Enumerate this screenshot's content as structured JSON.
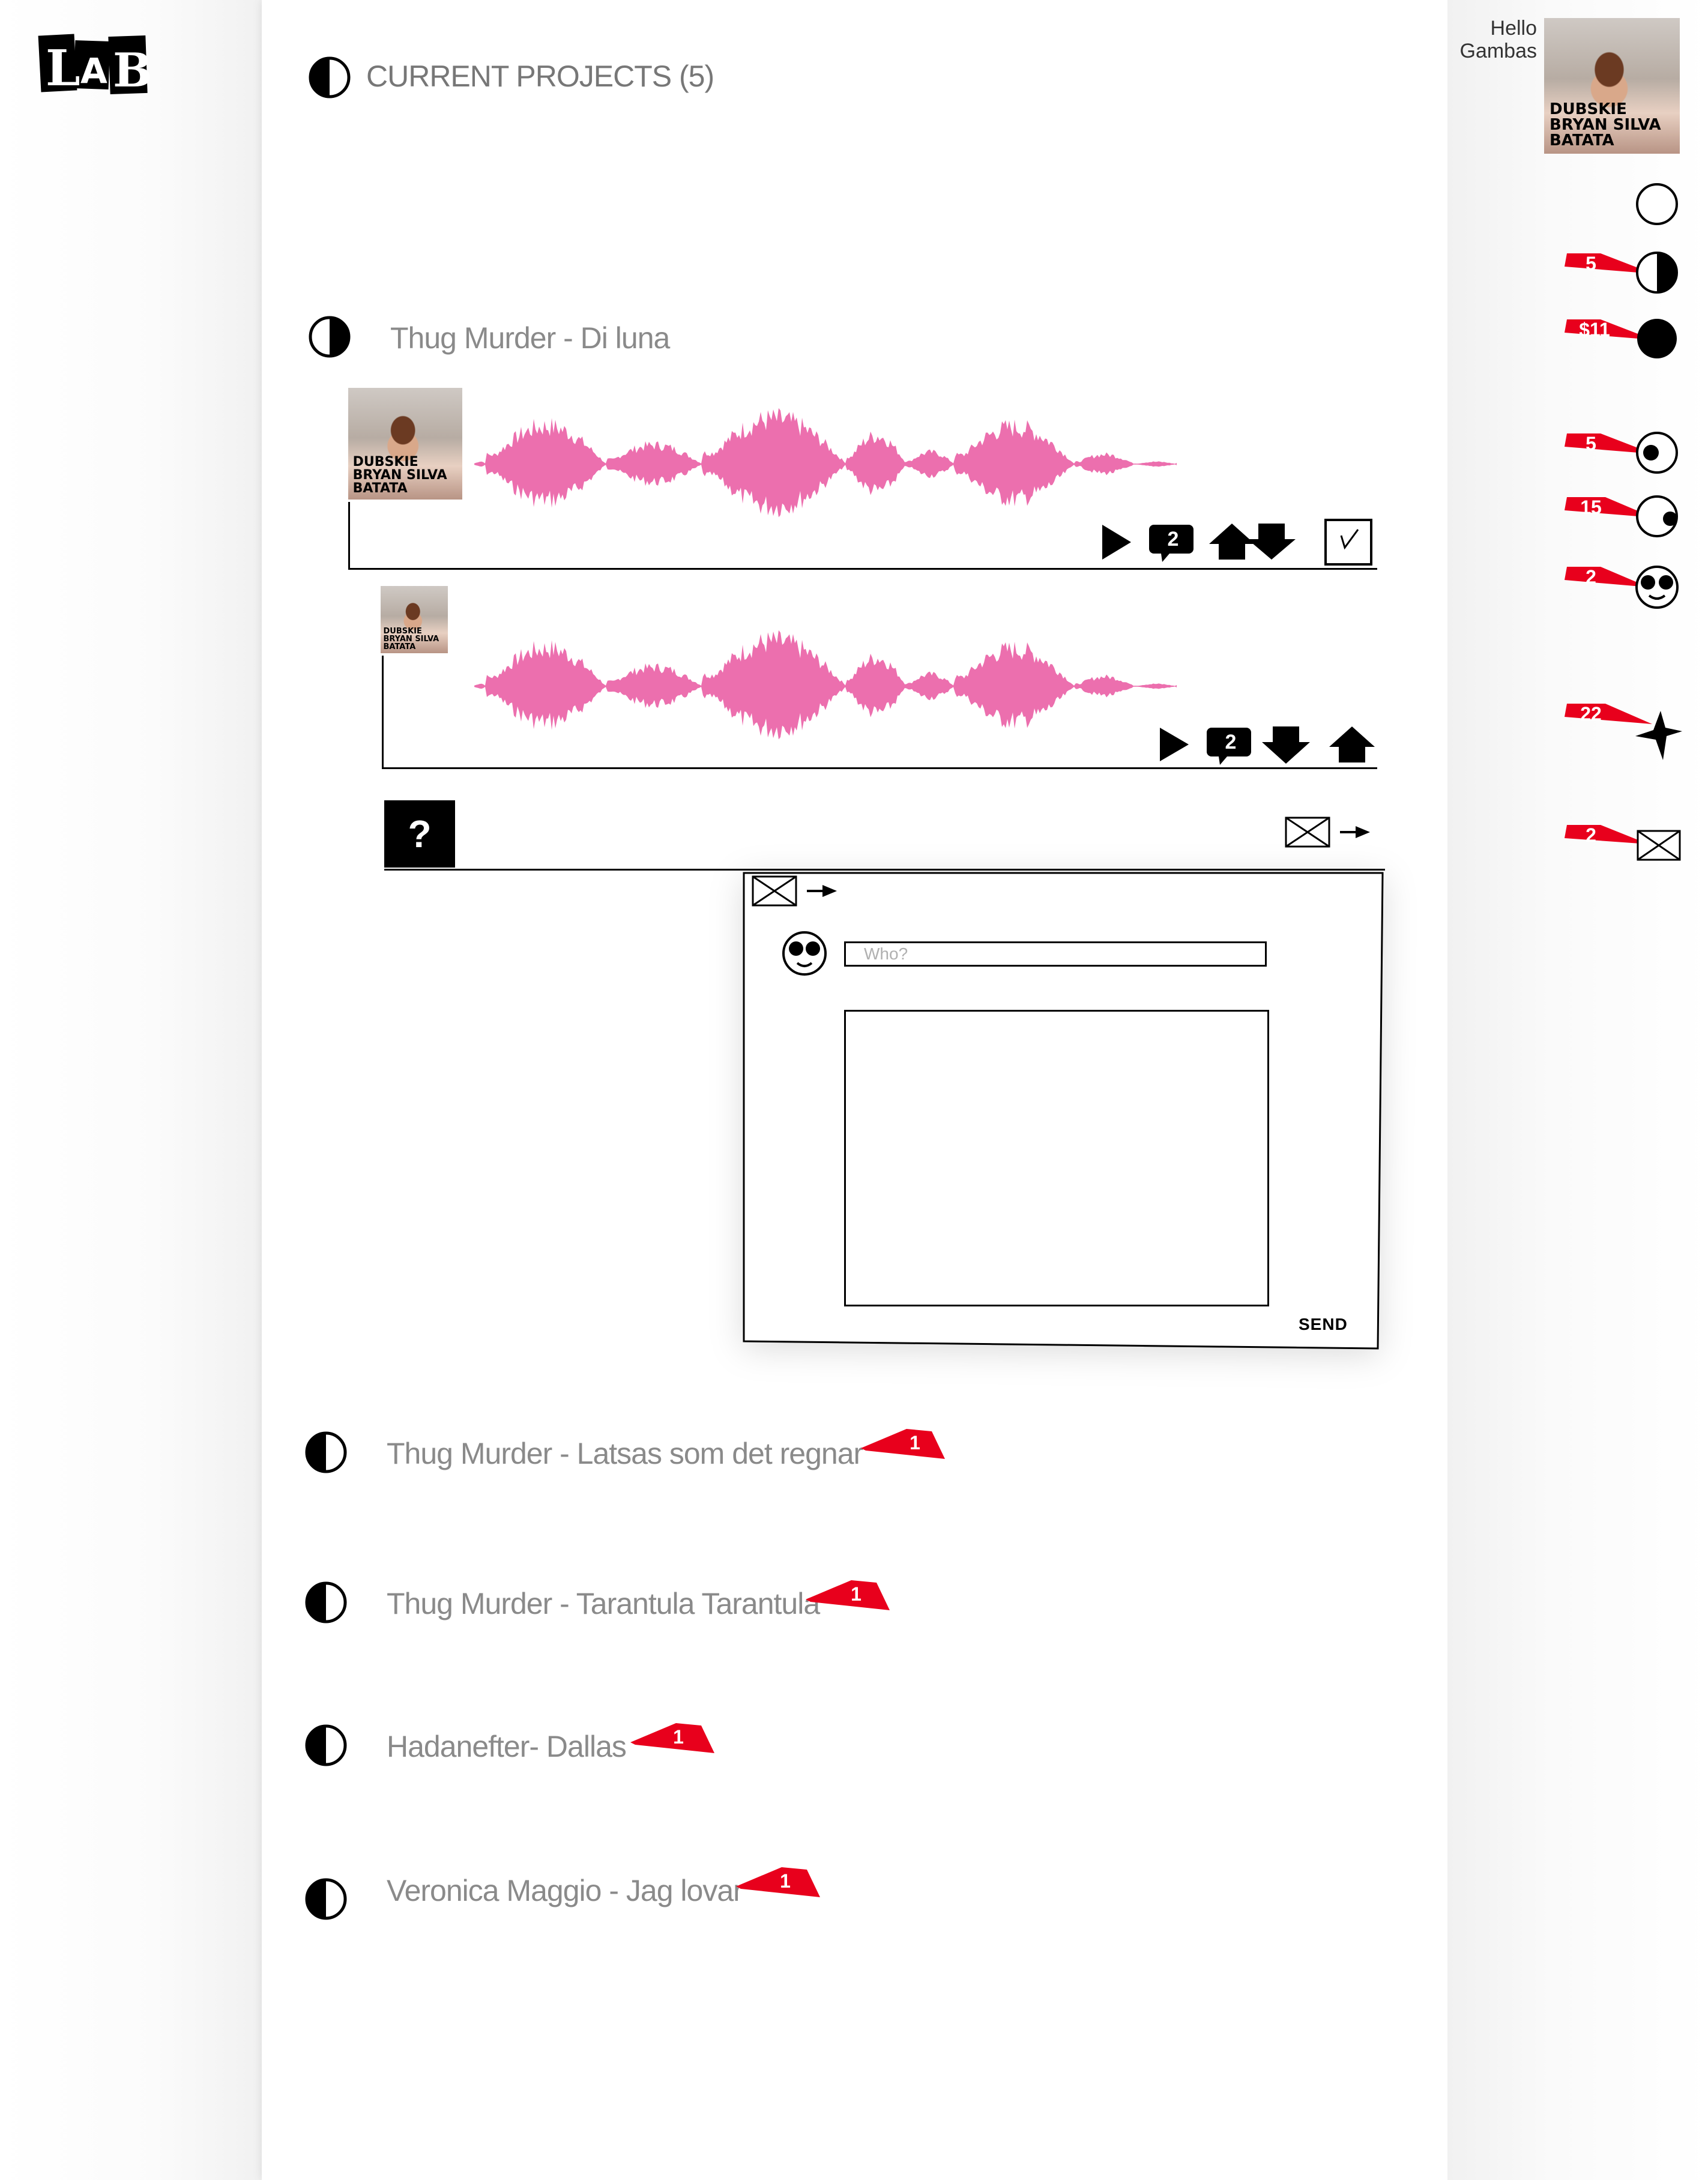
{
  "logo": {
    "text": "LAB"
  },
  "header": {
    "title": "CURRENT PROJECTS (5)"
  },
  "user": {
    "greeting": "Hello",
    "name": "Gambas",
    "avatar_caption": "DUBSKIE BRYAN SILVA BATATA"
  },
  "sidebar": {
    "items": [
      {
        "icon": "empty-circle-icon",
        "badge": ""
      },
      {
        "icon": "half-circle-icon",
        "badge": "5"
      },
      {
        "icon": "full-circle-icon",
        "badge": "$11"
      },
      {
        "icon": "dot-circle-icon",
        "badge": "5"
      },
      {
        "icon": "side-dot-circle-icon",
        "badge": "15"
      },
      {
        "icon": "smiley-icon",
        "badge": "2"
      },
      {
        "icon": "star-icon",
        "badge": "22"
      },
      {
        "icon": "envelope-icon",
        "badge": "2"
      }
    ]
  },
  "projects": [
    {
      "title": "Thug Murder - Di luna",
      "badge": ""
    },
    {
      "title": "Thug Murder - Latsas som det regnar",
      "badge": "1"
    },
    {
      "title": "Thug Murder - Tarantula Tarantula",
      "badge": "1"
    },
    {
      "title": "Hadanefter- Dallas",
      "badge": "1"
    },
    {
      "title": "Veronica Maggio - Jag lovar",
      "badge": "1"
    }
  ],
  "tracks": [
    {
      "comments": "2",
      "avatar_caption": "DUBSKIE BRYAN SILVA BATATA"
    },
    {
      "comments": "2",
      "avatar_caption": "DUBSKIE BRYAN SILVA BATATA"
    }
  ],
  "question": {
    "label": "?"
  },
  "message": {
    "to_placeholder": "Who?",
    "send_label": "SEND"
  },
  "colors": {
    "waveform": "#ec6fae",
    "badge": "#e8001c",
    "text_gray": "#8a8a8a"
  }
}
